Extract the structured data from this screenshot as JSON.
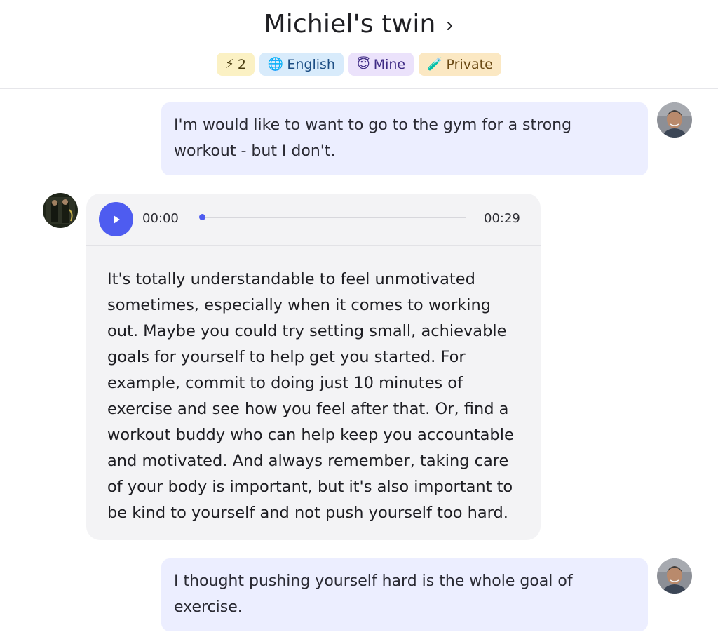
{
  "header": {
    "title": "Michiel's twin",
    "badges": [
      {
        "icon": "⚡",
        "label": "2",
        "bg": "#fbf1c4",
        "color": "#4a3d10"
      },
      {
        "icon": "🌐",
        "label": "English",
        "bg": "#d8ebfb",
        "color": "#1d4e84"
      },
      {
        "icon": "😇",
        "label": "Mine",
        "bg": "#ebe2fb",
        "color": "#3e2a84"
      },
      {
        "icon": "🧪",
        "label": "Private",
        "bg": "#fbe8c3",
        "color": "#6b4a14"
      }
    ]
  },
  "messages": [
    {
      "role": "user",
      "text": "I'm would like to want to go to the gym for a strong workout - but I don't."
    },
    {
      "role": "assistant",
      "audio": {
        "current": "00:00",
        "duration": "00:29",
        "progress": 0
      },
      "text": "It's totally understandable to feel unmotivated sometimes, especially when it comes to working out. Maybe you could try setting small, achievable goals for yourself to help get you started. For example, commit to doing just 10 minutes of exercise and see how you feel after that. Or, find a workout buddy who can help keep you accountable and motivated. And always remember, taking care of your body is important, but it's also important to be kind to yourself and not push yourself too hard."
    },
    {
      "role": "user",
      "text": "I thought pushing yourself hard is the whole goal of exercise."
    }
  ],
  "colors": {
    "accent": "#4e5cf0",
    "user_bubble": "#eceeff",
    "bot_bubble": "#f3f3f5"
  }
}
